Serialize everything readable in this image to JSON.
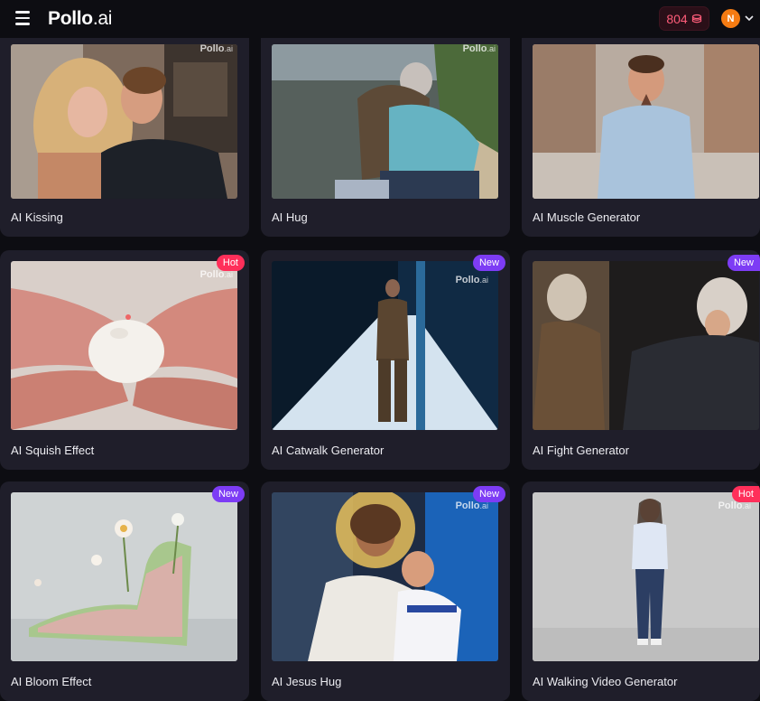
{
  "header": {
    "logo_main": "Pollo",
    "logo_suffix": ".ai",
    "credits": "804",
    "avatar_initial": "N"
  },
  "watermark": {
    "main": "Pollo",
    "suffix": ".ai"
  },
  "cards": [
    {
      "title": "AI Kissing",
      "badge": ""
    },
    {
      "title": "AI Hug",
      "badge": ""
    },
    {
      "title": "AI Muscle Generator",
      "badge": ""
    },
    {
      "title": "AI Squish Effect",
      "badge": "Hot"
    },
    {
      "title": "AI Catwalk Generator",
      "badge": "New"
    },
    {
      "title": "AI Fight Generator",
      "badge": "New"
    },
    {
      "title": "AI Bloom Effect",
      "badge": "New"
    },
    {
      "title": "AI Jesus Hug",
      "badge": "New"
    },
    {
      "title": "AI Walking Video Generator",
      "badge": "Hot"
    }
  ],
  "colors": {
    "hot": "#ff2f5a",
    "new": "#7d3cf5",
    "card_bg": "#1f1e2a",
    "page_bg": "#0d0d12"
  }
}
